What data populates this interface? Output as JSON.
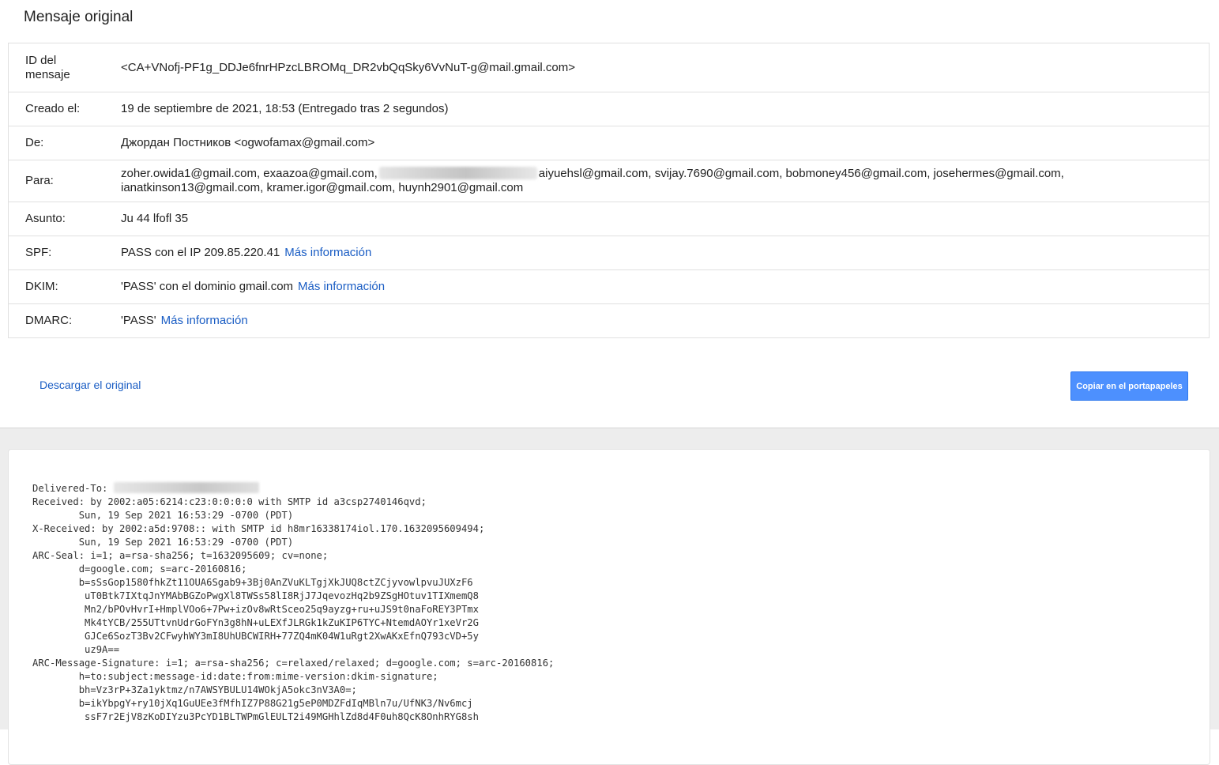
{
  "header": {
    "title": "Mensaje original"
  },
  "summary": {
    "message_id": {
      "label_line1": "ID del",
      "label_line2": "mensaje",
      "value": "<CA+VNofj-PF1g_DDJe6fnrHPzcLBROMq_DR2vbQqSky6VvNuT-g@mail.gmail.com>"
    },
    "created": {
      "label": "Creado el:",
      "value": "19 de septiembre de 2021, 18:53 (Entregado tras 2 segundos)"
    },
    "from": {
      "label": "De:",
      "value": "Джордан Постников <ogwofamax@gmail.com>"
    },
    "to": {
      "label": "Para:",
      "line1_before": "zoher.owida1@gmail.com, exaazoa@gmail.com,",
      "line1_after": "aiyuehsl@gmail.com, svijay.7690@gmail.com, bobmoney456@gmail.com, josehermes@gmail.com,",
      "line2": "ianatkinson13@gmail.com, kramer.igor@gmail.com, huynh2901@gmail.com"
    },
    "subject": {
      "label": "Asunto:",
      "value": "Ju 44 lfofl 35"
    },
    "spf": {
      "label": "SPF:",
      "value": "PASS con el IP 209.85.220.41",
      "link": "Más información"
    },
    "dkim": {
      "label": "DKIM:",
      "value": "'PASS' con el dominio gmail.com",
      "link": "Más información"
    },
    "dmarc": {
      "label": "DMARC:",
      "value": "'PASS'",
      "link": "Más información"
    }
  },
  "actions": {
    "download_label": "Descargar el original",
    "copy_label": "Copiar en el portapapeles"
  },
  "raw": {
    "delivered_to_label": "Delivered-To: ",
    "lines": [
      "Received: by 2002:a05:6214:c23:0:0:0:0 with SMTP id a3csp2740146qvd;",
      "        Sun, 19 Sep 2021 16:53:29 -0700 (PDT)",
      "X-Received: by 2002:a5d:9708:: with SMTP id h8mr16338174iol.170.1632095609494;",
      "        Sun, 19 Sep 2021 16:53:29 -0700 (PDT)",
      "ARC-Seal: i=1; a=rsa-sha256; t=1632095609; cv=none;",
      "        d=google.com; s=arc-20160816;",
      "        b=sSsGop1580fhkZt11OUA6Sgab9+3Bj0AnZVuKLTgjXkJUQ8ctZCjyvowlpvuJUXzF6",
      "         uT0Btk7IXtqJnYMAbBGZoPwgXl8TWSs58lI8RjJ7JqevozHq2b9ZSgHOtuv1TIXmemQ8",
      "         Mn2/bPOvHvrI+HmplVOo6+7Pw+izOv8wRtSceo25q9ayzg+ru+uJS9t0naFoREY3PTmx",
      "         Mk4tYCB/255UTtvnUdrGoFYn3g8hN+uLEXfJLRGk1kZuKIP6TYC+NtemdAOYr1xeVr2G",
      "         GJCe6SozT3Bv2CFwyhWY3mI8UhUBCWIRH+77ZQ4mK04W1uRgt2XwAKxEfnQ793cVD+5y",
      "         uz9A==",
      "ARC-Message-Signature: i=1; a=rsa-sha256; c=relaxed/relaxed; d=google.com; s=arc-20160816;",
      "        h=to:subject:message-id:date:from:mime-version:dkim-signature;",
      "        bh=Vz3rP+3Za1yktmz/n7AWSYBULU14WOkjA5okc3nV3A0=;",
      "        b=ikYbpgY+ry10jXq1GuUEe3fMfhIZ7P88G21g5eP0MDZFdIqMBln7u/UfNK3/Nv6mcj",
      "         ssF7r2EjV8zKoDIYzu3PcYD1BLTWPmGlEULT2i49MGHhlZd8d4F0uh8QcK8OnhRYG8sh"
    ]
  }
}
